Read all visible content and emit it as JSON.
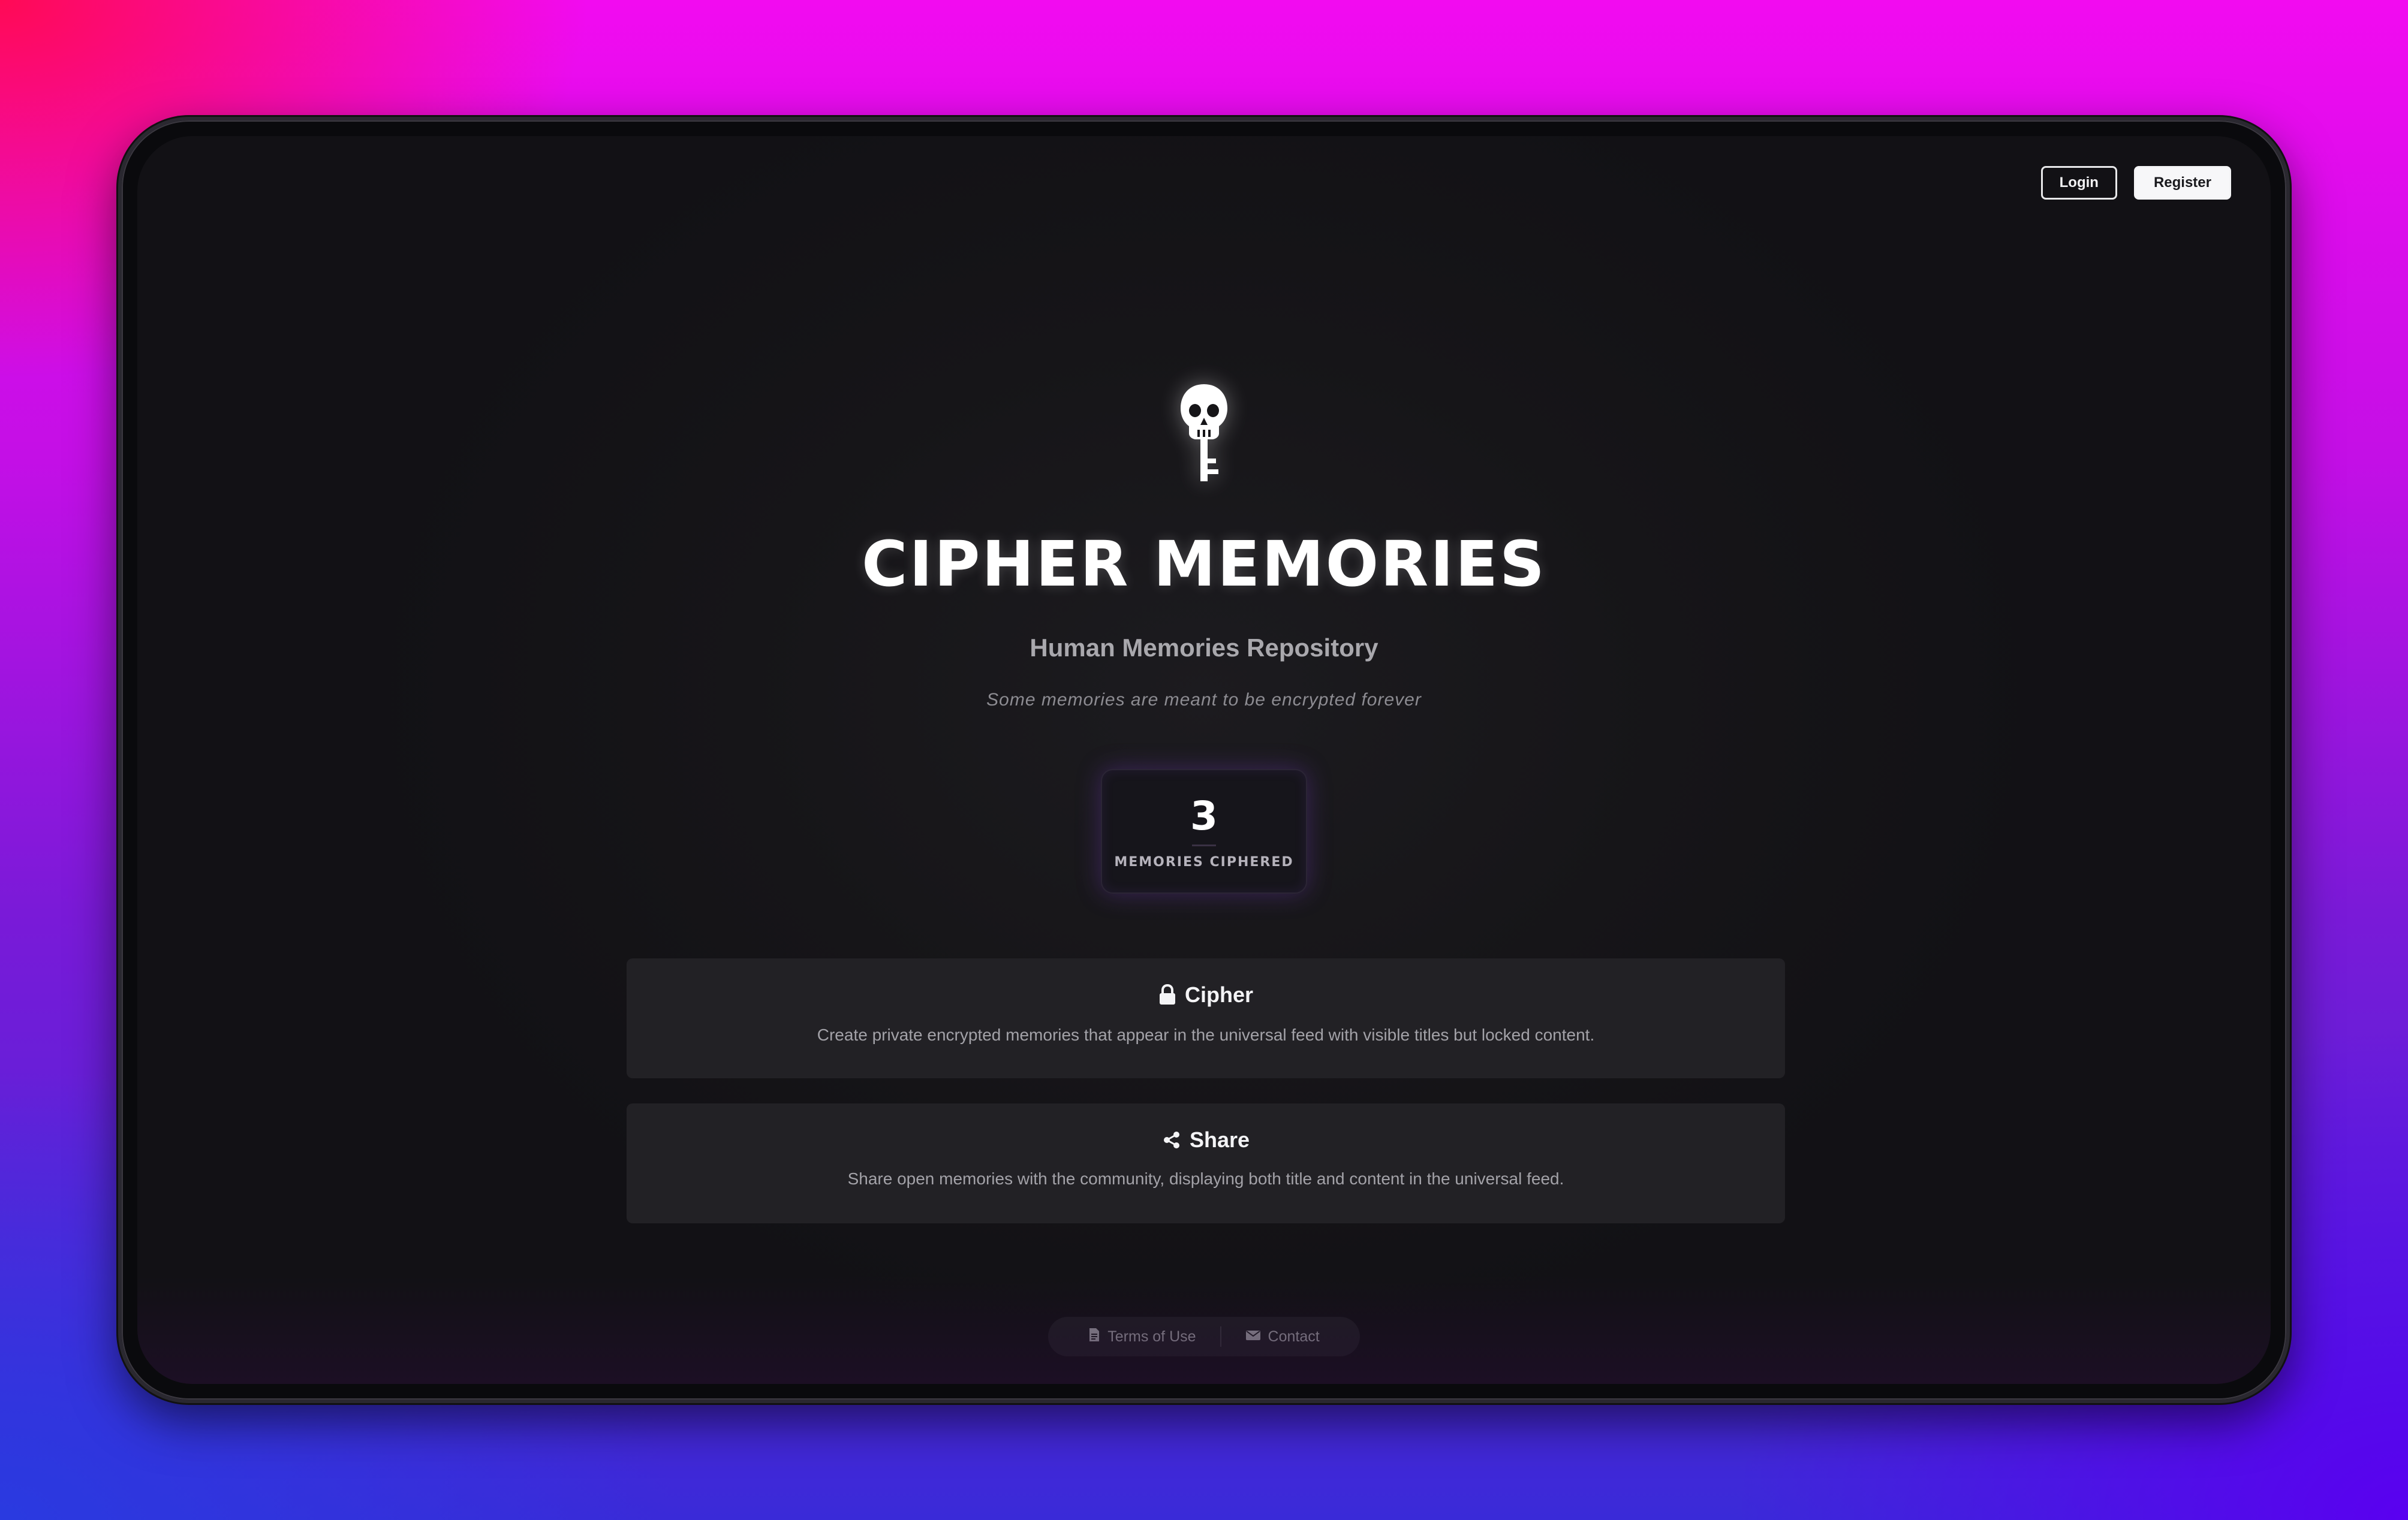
{
  "nav": {
    "login_label": "Login",
    "register_label": "Register"
  },
  "hero": {
    "logo_icon": "skull-key-icon",
    "title": "CIPHER MEMORIES",
    "subtitle": "Human Memories Repository",
    "tagline": "Some memories are meant to be encrypted forever"
  },
  "stats": {
    "value": "3",
    "label": "MEMORIES CIPHERED"
  },
  "features": [
    {
      "icon": "lock-icon",
      "title": "Cipher",
      "description": "Create private encrypted memories that appear in the universal feed with visible titles but locked content."
    },
    {
      "icon": "share-icon",
      "title": "Share",
      "description": "Share open memories with the community, displaying both title and content in the universal feed."
    }
  ],
  "footer": {
    "links": [
      {
        "icon": "document-icon",
        "label": "Terms of Use"
      },
      {
        "icon": "envelope-icon",
        "label": "Contact"
      }
    ]
  },
  "colors": {
    "background_gradient_top": "#f20bf0",
    "background_gradient_bottom": "#3a2ad8",
    "screen_background": "#161518",
    "card_background": "#222125",
    "stat_glow": "#7a3cc8"
  }
}
